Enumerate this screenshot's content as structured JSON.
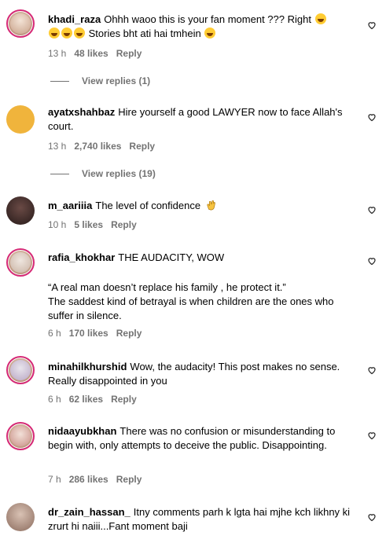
{
  "comments": [
    {
      "username": "khadi_raza",
      "text_a": "Ohhh waoo this is your fan moment ??? Right ",
      "text_b": " Stories bht ati hai tmhein ",
      "time": "13 h",
      "likes": "48 likes",
      "reply": "Reply",
      "view_replies": "View replies (1)"
    },
    {
      "username": "ayatxshahbaz",
      "text": "Hire yourself a good LAWYER now to face Allah's court.",
      "time": "13 h",
      "likes": "2,740 likes",
      "reply": "Reply",
      "view_replies": "View replies (19)"
    },
    {
      "username": "m_aariiia",
      "text": "The level of confidence",
      "time": "10 h",
      "likes": "5 likes",
      "reply": "Reply"
    },
    {
      "username": "rafia_khokhar",
      "text": "THE AUDACITY, WOW",
      "text_p2": "“A real man doesn’t replace his family , he protect it.”",
      "text_p3": "The saddest kind of betrayal is when children are the ones who suffer in silence.",
      "time": "6 h",
      "likes": "170 likes",
      "reply": "Reply"
    },
    {
      "username": "minahilkhurshid",
      "text": "Wow, the audacity! This post makes no sense. Really disappointed in you",
      "time": "6 h",
      "likes": "62 likes",
      "reply": "Reply"
    },
    {
      "username": "nidaayubkhan",
      "text": "There was no confusion or misunderstanding to begin with, only attempts to deceive the public. Disappointing.",
      "time": "7 h",
      "likes": "286 likes",
      "reply": "Reply"
    },
    {
      "username": "dr_zain_hassan_",
      "text": "Itny comments parh k lgta hai mjhe kch likhny ki zrurt hi naiii...Fant moment baji"
    }
  ],
  "icons": {
    "like": "heart-outline-icon",
    "laugh": "tears-of-joy-emoji",
    "clap": "clapping-hands-emoji"
  },
  "colors": {
    "muted": "#737373",
    "story_ring": "#d62976"
  }
}
